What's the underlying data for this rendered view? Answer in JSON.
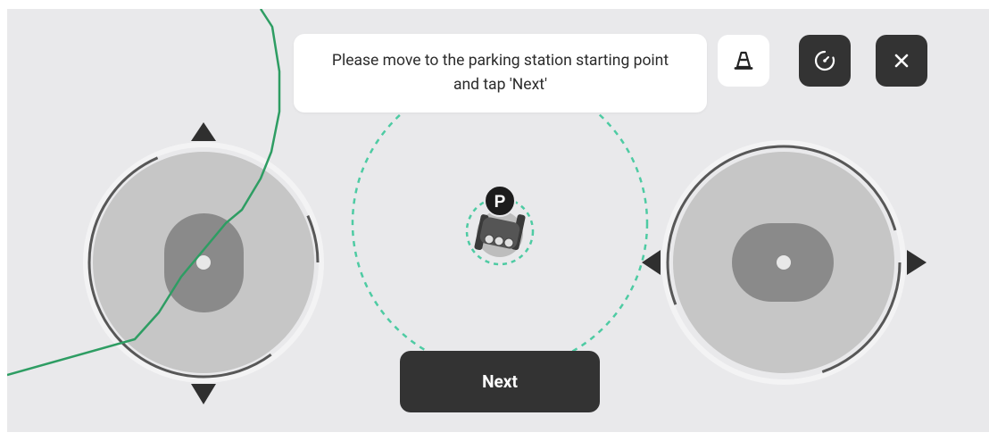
{
  "instruction": {
    "text": "Please move to the parking station starting point and tap 'Next'"
  },
  "toolbar": {
    "cone_icon": "traffic-cone-icon",
    "rotate_icon": "rotate-icon",
    "close_icon": "close-icon"
  },
  "marker": {
    "label": "P"
  },
  "next_button": {
    "label": "Next"
  },
  "colors": {
    "background": "#e9e9eb",
    "dark": "#333333",
    "path_green": "#2e9d63",
    "dashed_teal": "#4ecba3",
    "joystick_base": "#c6c6c6",
    "joystick_thumb": "#8a8a8a"
  }
}
